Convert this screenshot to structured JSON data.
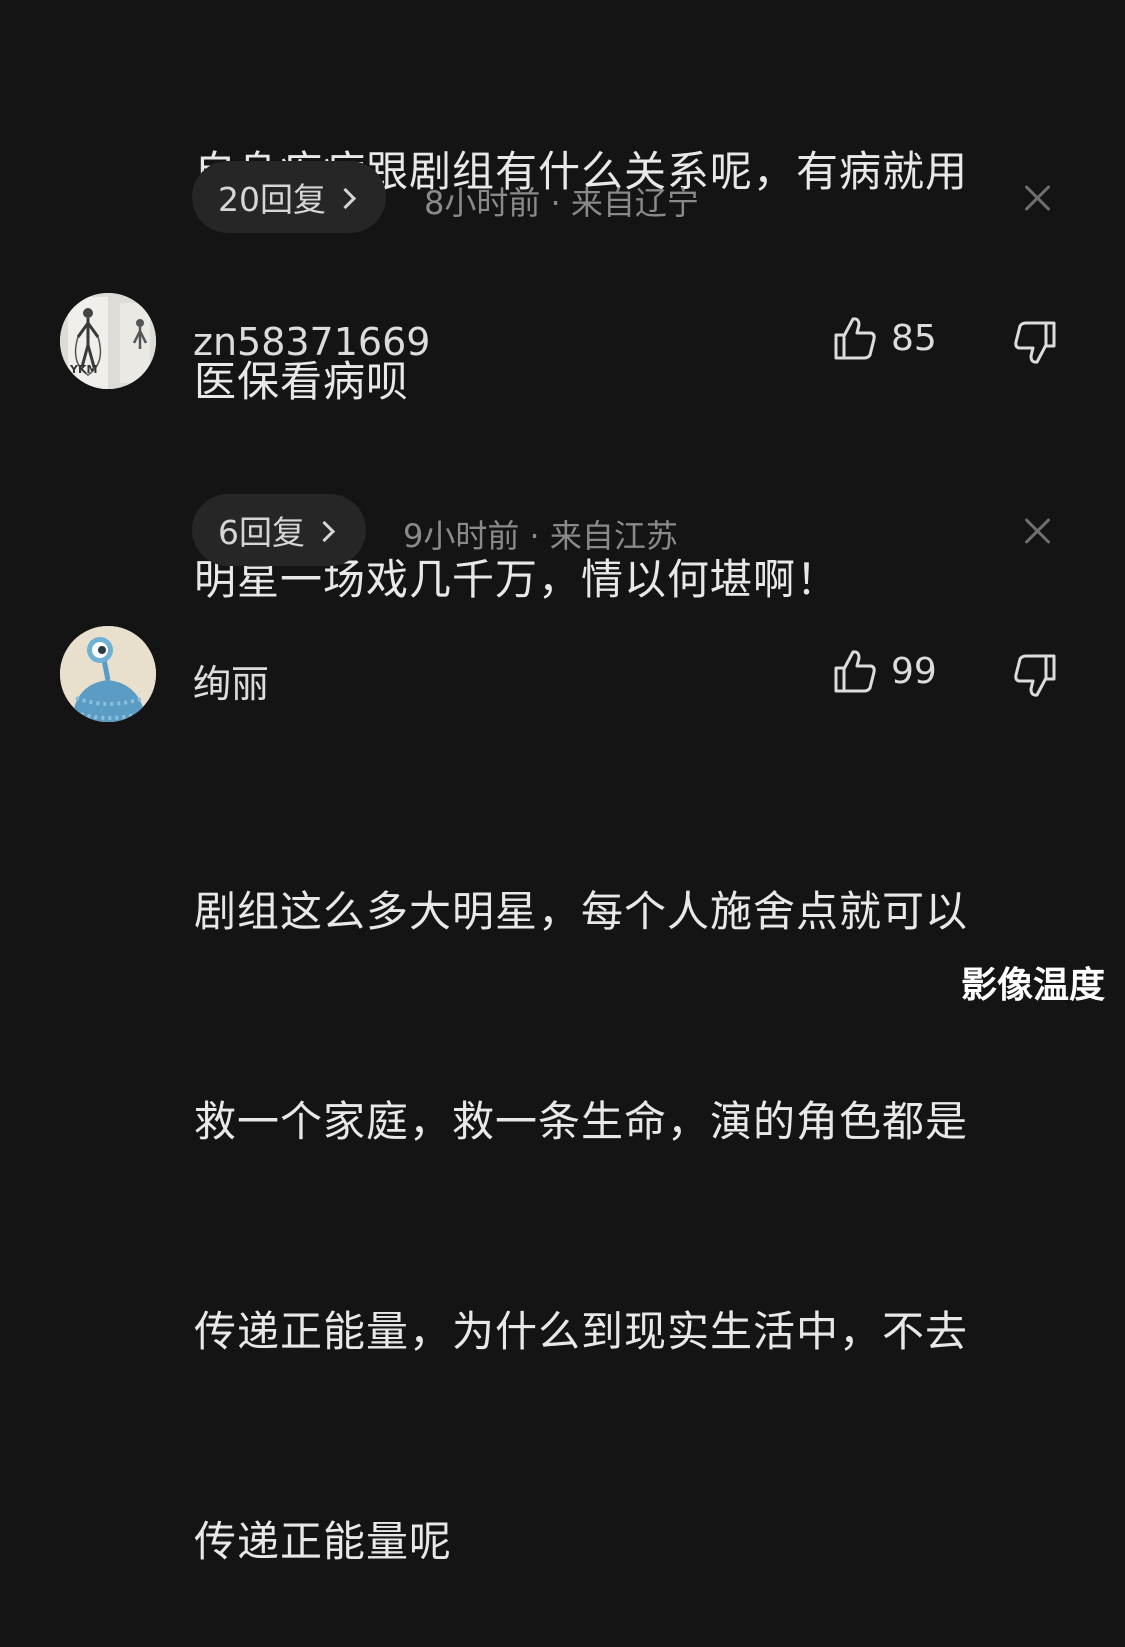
{
  "comments": [
    {
      "text_lines": [
        "自身疾病跟剧组有什么关系呢，有病就用",
        "医保看病呗"
      ],
      "reply_label": "20回复",
      "meta": "8小时前 · 来自辽宁"
    },
    {
      "username": "zn58371669",
      "avatar_label": "YKM",
      "likes": "85",
      "text_lines": [
        "明星一场戏几千万，情以何堪啊！"
      ],
      "reply_label": "6回复",
      "meta": "9小时前 · 来自江苏"
    },
    {
      "username": "绚丽",
      "likes": "99",
      "text_lines": [
        "剧组这么多大明星，每个人施舍点就可以",
        "救一个家庭，救一条生命，演的角色都是",
        "传递正能量，为什么到现实生活中，不去",
        "传递正能量呢"
      ]
    }
  ],
  "watermark": "影像温度",
  "icons": {
    "like": "thumbs-up-icon",
    "dislike": "thumbs-down-icon",
    "close": "close-icon",
    "chevron": "chevron-right-icon"
  },
  "colors": {
    "background": "#141414",
    "text": "#e8e8e8",
    "meta": "#8a8a8a",
    "pill": "#262626"
  }
}
